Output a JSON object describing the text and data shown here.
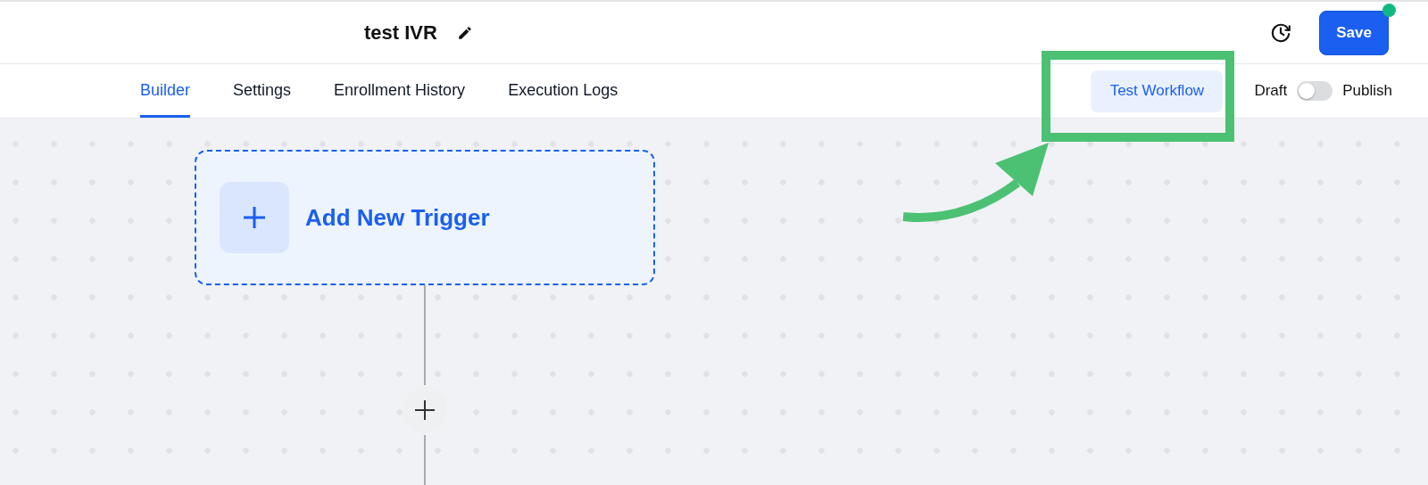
{
  "header": {
    "title": "test IVR",
    "save_label": "Save",
    "unsaved": true
  },
  "tabs": [
    {
      "label": "Builder",
      "selected": true
    },
    {
      "label": "Settings",
      "selected": false
    },
    {
      "label": "Enrollment History",
      "selected": false
    },
    {
      "label": "Execution Logs",
      "selected": false
    }
  ],
  "test_button": {
    "label": "Test Workflow"
  },
  "status": {
    "draft_label": "Draft",
    "publish_label": "Publish",
    "on": false
  },
  "canvas": {
    "trigger_label": "Add New Trigger"
  }
}
